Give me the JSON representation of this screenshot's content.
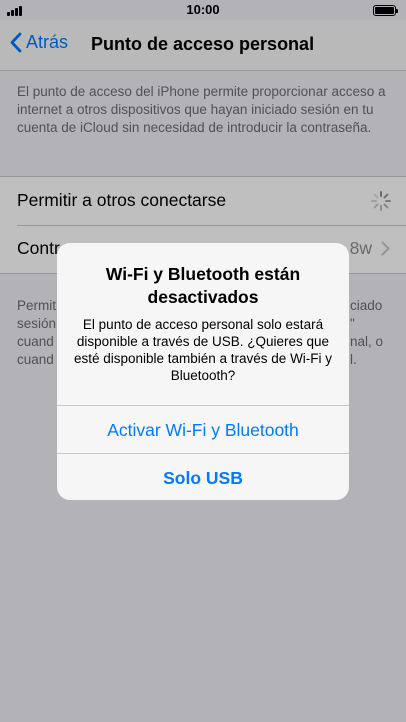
{
  "status_bar": {
    "time": "10:00"
  },
  "nav": {
    "back_label": "Atrás",
    "title": "Punto de acceso personal"
  },
  "description": "El punto de acceso del iPhone permite proporcionar acceso a internet a otros dispositivos que hayan iniciado sesión en tu cuenta de iCloud sin necesidad de introducir la contraseña.",
  "settings": {
    "allow_label": "Permitir a otros conectarse",
    "password_label": "Contr",
    "password_value": "8w"
  },
  "footer_partial": {
    "left_lines": [
      "Permit",
      "sesión",
      "cuand",
      "cuand"
    ],
    "right_lines": [
      "ciado",
      "\"",
      "nal, o",
      "l."
    ]
  },
  "alert": {
    "title": "Wi-Fi y Bluetooth están desactivados",
    "message": "El punto de acceso personal solo estará disponible a través de USB. ¿Quieres que esté disponible también a través de Wi-Fi y Bluetooth?",
    "button_primary": "Activar Wi-Fi y Bluetooth",
    "button_secondary": "Solo USB"
  },
  "colors": {
    "accent": "#007aff",
    "background": "#efeff4"
  }
}
